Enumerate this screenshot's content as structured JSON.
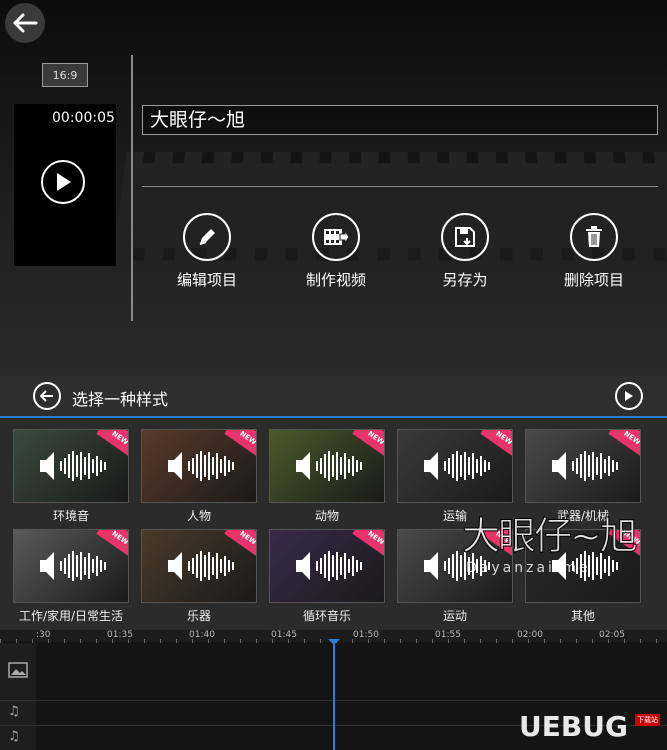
{
  "editor": {
    "aspect_ratio": "16:9",
    "timecode": "00:00:05",
    "project_title": "大眼仔～旭",
    "actions": [
      {
        "label": "编辑项目",
        "icon": "pencil-icon"
      },
      {
        "label": "制作视频",
        "icon": "film-export-icon"
      },
      {
        "label": "另存为",
        "icon": "save-as-icon"
      },
      {
        "label": "删除项目",
        "icon": "trash-icon"
      }
    ]
  },
  "style_picker": {
    "title": "选择一种样式",
    "badge_text": "NEW",
    "styles": [
      {
        "label": "环境音",
        "bg": "#3a4a3e"
      },
      {
        "label": "人物",
        "bg": "#5a3a2a"
      },
      {
        "label": "动物",
        "bg": "#4a5a2a"
      },
      {
        "label": "运输",
        "bg": "#3a3a3a"
      },
      {
        "label": "武器/机械",
        "bg": "#4a4a4a"
      },
      {
        "label": "工作/家用/日常生活",
        "bg": "#5a5a5a"
      },
      {
        "label": "乐器",
        "bg": "#4a3a2a"
      },
      {
        "label": "循环音乐",
        "bg": "#3a2a4a"
      },
      {
        "label": "运动",
        "bg": "#4a4a4a"
      },
      {
        "label": "其他",
        "bg": "#2a2a2a"
      }
    ]
  },
  "timeline": {
    "ticks": [
      ":30",
      "01:35",
      "01:40",
      "01:45",
      "01:50",
      "01:55",
      "02:00",
      "02:05"
    ]
  },
  "watermarks": {
    "main": "大眼仔~旭",
    "main_sub": "Dayanzai.me",
    "corner": "UEBUG",
    "corner_sub": "下载站"
  },
  "colors": {
    "accent": "#2a7fd4",
    "badge": "#e8336b"
  }
}
